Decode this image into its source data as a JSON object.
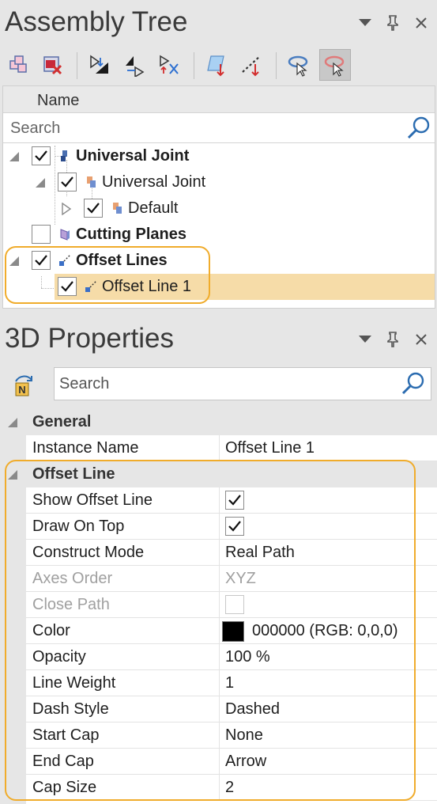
{
  "assembly_panel": {
    "title": "Assembly Tree",
    "controls": [
      "dropdown-icon",
      "pin-icon",
      "close-icon"
    ],
    "toolbar": [
      "insert-assembly-icon",
      "remove-assembly-icon",
      "move-down-right-icon",
      "move-left-right-icon",
      "move-up-cross-icon",
      "plane-down-icon",
      "offset-line-down-icon",
      "rotate-select-icon",
      "rotate-select-active-icon"
    ],
    "column_header": "Name",
    "search_placeholder": "Search",
    "rows": [
      {
        "label": "Universal Joint",
        "checked": true,
        "bold": true,
        "icon": "universal-joint-icon"
      },
      {
        "label": "Universal Joint",
        "checked": true,
        "bold": false,
        "icon": "part-icon"
      },
      {
        "label": "Default",
        "checked": true,
        "bold": false,
        "icon": "part-icon"
      },
      {
        "label": "Cutting Planes",
        "checked": false,
        "bold": true,
        "icon": "cutting-planes-icon"
      },
      {
        "label": "Offset Lines",
        "checked": true,
        "bold": true,
        "icon": "offset-lines-icon"
      },
      {
        "label": "Offset Line 1",
        "checked": true,
        "bold": false,
        "icon": "offset-line-icon",
        "selected": true
      }
    ]
  },
  "properties_panel": {
    "title": "3D Properties",
    "controls": [
      "dropdown-icon",
      "pin-icon",
      "close-icon"
    ],
    "mode_icon": "toggle-mode-icon",
    "search_placeholder": "Search",
    "categories": [
      {
        "name": "General",
        "properties": [
          {
            "name": "Instance Name",
            "value": "Offset Line 1"
          }
        ]
      },
      {
        "name": "Offset Line",
        "properties": [
          {
            "name": "Show Offset Line",
            "type": "checkbox",
            "checked": true
          },
          {
            "name": "Draw On Top",
            "type": "checkbox",
            "checked": true
          },
          {
            "name": "Construct Mode",
            "value": "Real Path"
          },
          {
            "name": "Axes Order",
            "value": "XYZ",
            "disabled": true
          },
          {
            "name": "Close Path",
            "type": "checkbox",
            "checked": false,
            "disabled": true
          },
          {
            "name": "Color",
            "type": "color",
            "swatch": "#000000",
            "value": "000000 (RGB: 0,0,0)"
          },
          {
            "name": "Opacity",
            "value": "100 %"
          },
          {
            "name": "Line Weight",
            "value": "1"
          },
          {
            "name": "Dash Style",
            "value": "Dashed"
          },
          {
            "name": "Start Cap",
            "value": "None"
          },
          {
            "name": "End Cap",
            "value": "Arrow"
          },
          {
            "name": "Cap Size",
            "value": "2"
          }
        ]
      }
    ]
  },
  "colors": {
    "highlight_outline": "#f0ac2c",
    "selection_fill": "#f6dca8",
    "panel_bg": "#e6e6e6"
  }
}
